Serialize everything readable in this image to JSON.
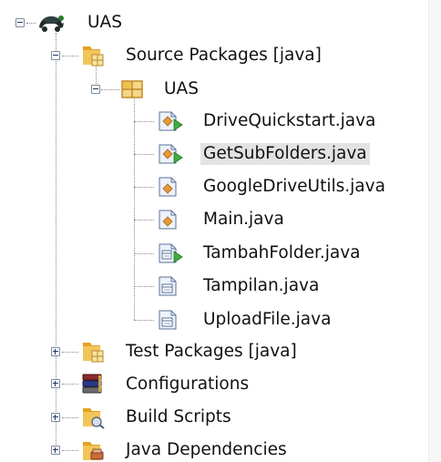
{
  "tree": {
    "project": {
      "label": "UAS",
      "icon": "netbeans-project-icon",
      "expanded": true
    },
    "source_packages": {
      "label": "Source Packages [java]",
      "icon": "source-folder-icon",
      "expanded": true
    },
    "package": {
      "label": "UAS",
      "icon": "package-icon",
      "expanded": true
    },
    "files": [
      {
        "label": "DriveQuickstart.java",
        "icon": "runnable-java-class-icon",
        "selected": false
      },
      {
        "label": "GetSubFolders.java",
        "icon": "runnable-java-class-icon",
        "selected": true
      },
      {
        "label": "GoogleDriveUtils.java",
        "icon": "java-class-icon",
        "selected": false
      },
      {
        "label": "Main.java",
        "icon": "java-class-icon",
        "selected": false
      },
      {
        "label": "TambahFolder.java",
        "icon": "runnable-form-class-icon",
        "selected": false
      },
      {
        "label": "Tampilan.java",
        "icon": "form-class-icon",
        "selected": false
      },
      {
        "label": "UploadFile.java",
        "icon": "form-class-icon",
        "selected": false
      }
    ],
    "test_packages": {
      "label": "Test Packages [java]",
      "icon": "test-folder-icon",
      "expanded": false
    },
    "configurations": {
      "label": "Configurations",
      "icon": "configurations-icon",
      "expanded": false
    },
    "build_scripts": {
      "label": "Build Scripts",
      "icon": "build-scripts-icon",
      "expanded": false
    },
    "java_dependencies": {
      "label": "Java Dependencies",
      "icon": "java-dependencies-icon",
      "expanded": false
    }
  }
}
